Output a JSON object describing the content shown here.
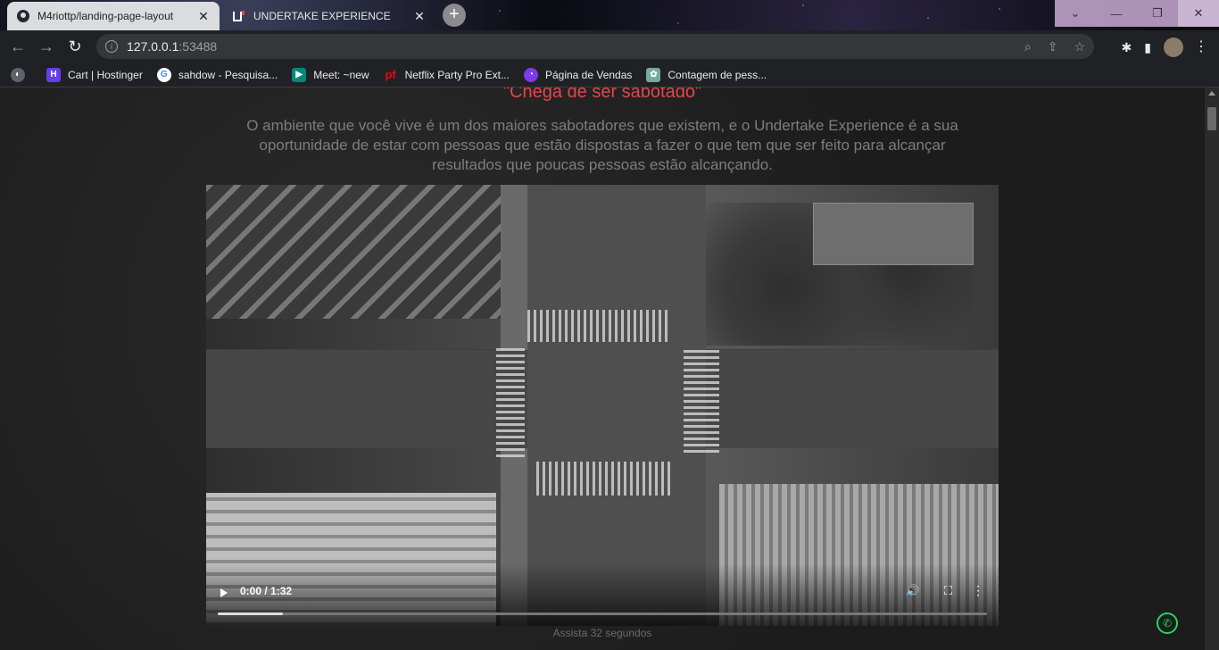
{
  "browser": {
    "tabs": [
      {
        "title": "M4riottp/landing-page-layout",
        "icon": "github-icon",
        "active": true
      },
      {
        "title": "UNDERTAKE EXPERIENCE",
        "icon": "undertake-logo-icon",
        "active": false
      }
    ],
    "new_tab_label": "+",
    "url_host": "127.0.0.1",
    "url_port": ":53488",
    "bookmarks": [
      {
        "label": "Cart | Hostinger",
        "icon": "hostinger-icon",
        "color": "#673de6"
      },
      {
        "label": "sahdow - Pesquisa...",
        "icon": "google-icon",
        "color": "#ffffff"
      },
      {
        "label": "Meet: ~new",
        "icon": "meet-icon",
        "color": "#00897b"
      },
      {
        "label": "Netflix Party Pro Ext...",
        "icon": "pf-icon",
        "color": "#e50914"
      },
      {
        "label": "Página de Vendas",
        "icon": "vendas-icon",
        "color": "#7c3aed"
      },
      {
        "label": "Contagem de pess...",
        "icon": "openai-icon",
        "color": "#74aa9c"
      }
    ]
  },
  "page": {
    "headline": "\"Chega de ser sabotado\"",
    "intro": "O ambiente que você vive é um dos maiores sabotadores que existem, e o Undertake Experience é a sua oportunidade de estar com pessoas que estão dispostas a fazer o que tem que ser feito para alcançar resultados que poucas pessoas estão alcançando.",
    "video": {
      "time": "0:00 / 1:32",
      "progress_fraction": 0.085
    },
    "caption": "Assista 32 segundos"
  },
  "colors": {
    "accent_red": "#e0484a",
    "whatsapp_green": "#25d366"
  }
}
